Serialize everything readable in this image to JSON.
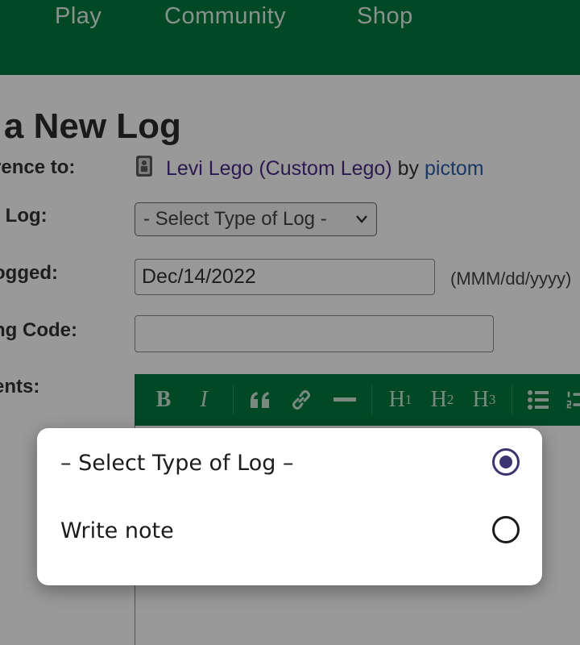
{
  "nav": {
    "items": [
      "Play",
      "Community",
      "Shop"
    ]
  },
  "page": {
    "title": "t a New Log",
    "reference_label": "rence to:",
    "cache_name": "Levi Lego (Custom Lego)",
    "by_text": "by",
    "owner": "pictom",
    "type_label": "f Log:",
    "type_select_value": "- Select Type of Log -",
    "date_label": "ogged:",
    "date_value": "Dec/14/2022",
    "date_hint": "(MMM/dd/yyyy)",
    "code_label": "ng Code:",
    "code_value": "",
    "comments_label": "ents:"
  },
  "toolbar": {
    "bold": "B",
    "italic": "I",
    "h1": "H1",
    "h2": "H2",
    "h3": "H3"
  },
  "dialog": {
    "options": [
      {
        "label": "– Select Type of Log –",
        "checked": true
      },
      {
        "label": "Write note",
        "checked": false
      }
    ]
  },
  "colors": {
    "brand_green": "#02793e",
    "radio_accent": "#3b3470"
  }
}
